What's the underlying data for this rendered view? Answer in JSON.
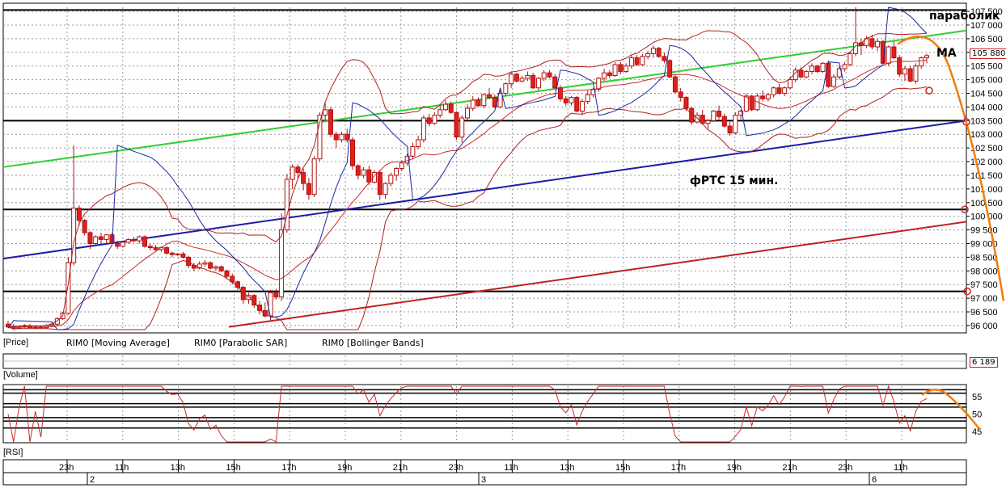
{
  "colors": {
    "candle_up": "#ffffff",
    "candle_down": "#e0201c",
    "moving_average": "#cc2a2a",
    "parabolic_sar": "#1c2aa0",
    "bollinger": "#b02020",
    "green_trend": "#2fd02f",
    "blue_trend": "#1c1ca8",
    "red_trend": "#c02020",
    "orange_projection": "#f07d10",
    "grid": "#9a9a9a",
    "badge_border": "#d02020"
  },
  "annotations": {
    "parabolic": "параболик",
    "ma": "МА",
    "title": "фРТС   15 мин."
  },
  "legend": {
    "price": "[Price]",
    "ma": "RIM0 [Moving Average]",
    "sar": "RIM0 [Parabolic SAR]",
    "bb": "RIM0 [Bollinger Bands]"
  },
  "volume": {
    "label": "[Volume]",
    "value_badge": "6 189"
  },
  "rsi": {
    "label": "[RSI]"
  },
  "price_badge": "105 880",
  "chart_data": [
    {
      "type": "candlestick",
      "title": "фРТС   15 мин.",
      "ylim": [
        95850,
        107650
      ],
      "y_ticks": [
        "96 000",
        "96 500",
        "97 000",
        "97 500",
        "98 000",
        "98 500",
        "99 000",
        "99 500",
        "100 000",
        "100 500",
        "101 000",
        "101 500",
        "102 000",
        "102 500",
        "103 000",
        "103 500",
        "104 000",
        "104 500",
        "105 000",
        "105 500",
        "106 000",
        "106 500",
        "107 000",
        "107 500"
      ],
      "x_ticks": [
        "23h",
        "11h",
        "13h",
        "15h",
        "17h",
        "19h",
        "21h",
        "23h",
        "11h",
        "13h",
        "15h",
        "17h",
        "19h",
        "21h",
        "23h",
        "11h"
      ],
      "day_labels": [
        "2",
        "3",
        "6"
      ],
      "ohlc": [
        [
          96050,
          96180,
          95900,
          95950
        ],
        [
          95950,
          96050,
          95850,
          95900
        ],
        [
          95900,
          96000,
          95870,
          95950
        ],
        [
          95950,
          96050,
          95900,
          95980
        ],
        [
          95980,
          96050,
          95900,
          95920
        ],
        [
          95920,
          96020,
          95880,
          95950
        ],
        [
          95950,
          96000,
          95880,
          95920
        ],
        [
          95920,
          96050,
          95880,
          96000
        ],
        [
          96000,
          96100,
          95950,
          96050
        ],
        [
          96050,
          96300,
          96000,
          96250
        ],
        [
          96250,
          96500,
          96200,
          96450
        ],
        [
          96450,
          98500,
          96400,
          98300
        ],
        [
          98300,
          102600,
          98200,
          100300
        ],
        [
          100300,
          100400,
          99650,
          99850
        ],
        [
          99850,
          99900,
          99300,
          99400
        ],
        [
          99400,
          99450,
          98800,
          99000
        ],
        [
          99000,
          99300,
          98950,
          99250
        ],
        [
          99250,
          99400,
          99000,
          99150
        ],
        [
          99150,
          99350,
          99000,
          99320
        ],
        [
          99320,
          99400,
          98950,
          99000
        ],
        [
          99000,
          99100,
          98800,
          98900
        ],
        [
          98900,
          99100,
          98850,
          99050
        ],
        [
          99050,
          99200,
          99000,
          99150
        ],
        [
          99150,
          99250,
          99050,
          99100
        ],
        [
          99100,
          99300,
          99000,
          99250
        ],
        [
          99250,
          99300,
          98850,
          98900
        ],
        [
          98900,
          99000,
          98750,
          98850
        ],
        [
          98850,
          98950,
          98700,
          98780
        ],
        [
          98780,
          98900,
          98700,
          98850
        ],
        [
          98850,
          98900,
          98600,
          98650
        ],
        [
          98650,
          98700,
          98500,
          98600
        ],
        [
          98600,
          98650,
          98550,
          98620
        ],
        [
          98620,
          98700,
          98450,
          98500
        ],
        [
          98500,
          98550,
          98100,
          98200
        ],
        [
          98200,
          98300,
          98000,
          98100
        ],
        [
          98100,
          98350,
          98050,
          98250
        ],
        [
          98250,
          98400,
          98150,
          98300
        ],
        [
          98300,
          98350,
          98050,
          98100
        ],
        [
          98100,
          98200,
          98000,
          98150
        ],
        [
          98150,
          98200,
          97950,
          98000
        ],
        [
          98000,
          98050,
          97700,
          97800
        ],
        [
          97800,
          97900,
          97500,
          97600
        ],
        [
          97600,
          97650,
          97300,
          97400
        ],
        [
          97400,
          97450,
          96800,
          96950
        ],
        [
          96950,
          97200,
          96800,
          97100
        ],
        [
          97100,
          97150,
          96650,
          96750
        ],
        [
          96750,
          96900,
          96400,
          96550
        ],
        [
          96550,
          96850,
          96300,
          96350
        ],
        [
          96350,
          97300,
          96200,
          97200
        ],
        [
          97200,
          97350,
          96950,
          97050
        ],
        [
          97050,
          100100,
          96900,
          99500
        ],
        [
          99500,
          101550,
          99400,
          101350
        ],
        [
          101350,
          101900,
          101000,
          101800
        ],
        [
          101800,
          101900,
          101400,
          101600
        ],
        [
          101600,
          101750,
          100950,
          101200
        ],
        [
          101200,
          101400,
          100600,
          100800
        ],
        [
          100800,
          102200,
          100700,
          102100
        ],
        [
          102100,
          103800,
          102000,
          103700
        ],
        [
          103700,
          104150,
          103500,
          103900
        ],
        [
          103900,
          104000,
          102900,
          103000
        ],
        [
          103000,
          103100,
          102500,
          102800
        ],
        [
          102800,
          103100,
          102700,
          103000
        ],
        [
          103000,
          103200,
          102700,
          102800
        ],
        [
          102800,
          102900,
          101700,
          101850
        ],
        [
          101850,
          101900,
          101350,
          101500
        ],
        [
          101500,
          101800,
          101400,
          101700
        ],
        [
          101700,
          101850,
          101150,
          101250
        ],
        [
          101250,
          101700,
          101200,
          101600
        ],
        [
          101600,
          101700,
          100600,
          100800
        ],
        [
          100800,
          101250,
          100650,
          101200
        ],
        [
          101200,
          101600,
          101100,
          101500
        ],
        [
          101500,
          101800,
          101300,
          101750
        ],
        [
          101750,
          102050,
          101650,
          101950
        ],
        [
          101950,
          102300,
          101850,
          102200
        ],
        [
          102200,
          102700,
          102100,
          102550
        ],
        [
          102550,
          102950,
          102450,
          102800
        ],
        [
          102800,
          103700,
          102700,
          103600
        ],
        [
          103600,
          103750,
          103300,
          103400
        ],
        [
          103400,
          103800,
          103350,
          103700
        ],
        [
          103700,
          104100,
          103600,
          103900
        ],
        [
          103900,
          104250,
          103850,
          104100
        ],
        [
          104100,
          104200,
          103750,
          103800
        ],
        [
          103800,
          103850,
          102800,
          102900
        ],
        [
          102900,
          103700,
          102700,
          103600
        ],
        [
          103600,
          104100,
          103500,
          103950
        ],
        [
          103950,
          104400,
          103850,
          104250
        ],
        [
          104250,
          104350,
          104000,
          104050
        ],
        [
          104050,
          104500,
          103950,
          104450
        ],
        [
          104450,
          104700,
          104300,
          104350
        ],
        [
          104350,
          104450,
          103950,
          104000
        ],
        [
          104000,
          104600,
          103950,
          104500
        ],
        [
          104500,
          104900,
          104400,
          104850
        ],
        [
          104850,
          105300,
          104700,
          105200
        ],
        [
          105200,
          105250,
          104900,
          104950
        ],
        [
          104950,
          105150,
          104900,
          105050
        ],
        [
          105050,
          105300,
          104950,
          105150
        ],
        [
          105150,
          105250,
          104650,
          104700
        ],
        [
          104700,
          105100,
          104600,
          105050
        ],
        [
          105050,
          105350,
          104950,
          105250
        ],
        [
          105250,
          105350,
          105050,
          105100
        ],
        [
          105100,
          105200,
          104650,
          104700
        ],
        [
          104700,
          104800,
          104200,
          104300
        ],
        [
          104300,
          104400,
          104050,
          104150
        ],
        [
          104150,
          104400,
          104050,
          104350
        ],
        [
          104350,
          104400,
          103800,
          103850
        ],
        [
          103850,
          104300,
          103700,
          104200
        ],
        [
          104200,
          104600,
          104100,
          104450
        ],
        [
          104450,
          104700,
          104350,
          104650
        ],
        [
          104650,
          105100,
          104550,
          105050
        ],
        [
          105050,
          105400,
          104950,
          105250
        ],
        [
          105250,
          105350,
          105050,
          105150
        ],
        [
          105150,
          105650,
          105100,
          105550
        ],
        [
          105550,
          105650,
          105200,
          105300
        ],
        [
          105300,
          105600,
          105250,
          105500
        ],
        [
          105500,
          105900,
          105400,
          105800
        ],
        [
          105800,
          105900,
          105500,
          105550
        ],
        [
          105550,
          105950,
          105500,
          105850
        ],
        [
          105850,
          106050,
          105750,
          105950
        ],
        [
          105950,
          106250,
          105800,
          106150
        ],
        [
          106150,
          106200,
          105800,
          105850
        ],
        [
          105850,
          106000,
          105600,
          105700
        ],
        [
          105700,
          105750,
          105050,
          105100
        ],
        [
          105100,
          105200,
          104500,
          104550
        ],
        [
          104550,
          104700,
          104200,
          104350
        ],
        [
          104350,
          104400,
          103850,
          103950
        ],
        [
          103950,
          104000,
          103350,
          103450
        ],
        [
          103450,
          103800,
          103400,
          103700
        ],
        [
          103700,
          103900,
          103350,
          103400
        ],
        [
          103400,
          103550,
          103200,
          103500
        ],
        [
          103500,
          103900,
          103450,
          103850
        ],
        [
          103850,
          104050,
          103550,
          103650
        ],
        [
          103650,
          103750,
          103250,
          103300
        ],
        [
          103300,
          103450,
          102950,
          103050
        ],
        [
          103050,
          103800,
          103000,
          103700
        ],
        [
          103700,
          103900,
          103550,
          103850
        ],
        [
          103850,
          104500,
          103800,
          104400
        ],
        [
          104400,
          104450,
          103850,
          103900
        ],
        [
          103900,
          104500,
          103850,
          104400
        ],
        [
          104400,
          104600,
          104200,
          104300
        ],
        [
          104300,
          104500,
          104200,
          104450
        ],
        [
          104450,
          104750,
          104350,
          104700
        ],
        [
          104700,
          104850,
          104450,
          104500
        ],
        [
          104500,
          104750,
          104400,
          104700
        ],
        [
          104700,
          105100,
          104650,
          105000
        ],
        [
          105000,
          105450,
          104900,
          105350
        ],
        [
          105350,
          105450,
          105050,
          105100
        ],
        [
          105100,
          105350,
          105050,
          105300
        ],
        [
          105300,
          105600,
          105200,
          105500
        ],
        [
          105500,
          105550,
          105250,
          105300
        ],
        [
          105300,
          105650,
          105250,
          105600
        ],
        [
          105600,
          105700,
          104700,
          104750
        ],
        [
          104750,
          105200,
          104700,
          105100
        ],
        [
          105100,
          105500,
          105000,
          105400
        ],
        [
          105400,
          105650,
          105300,
          105550
        ],
        [
          105550,
          106000,
          105500,
          105950
        ],
        [
          105950,
          107650,
          105850,
          106350
        ],
        [
          106350,
          106500,
          105900,
          106250
        ],
        [
          106250,
          106600,
          106150,
          106500
        ],
        [
          106500,
          106650,
          106100,
          106200
        ],
        [
          106200,
          106500,
          106050,
          106400
        ],
        [
          106400,
          106450,
          105550,
          105600
        ],
        [
          105600,
          106250,
          105500,
          106200
        ],
        [
          106200,
          106400,
          105750,
          105800
        ],
        [
          105800,
          105900,
          105100,
          105200
        ],
        [
          105200,
          105500,
          104950,
          105400
        ],
        [
          105400,
          105500,
          104900,
          104950
        ],
        [
          104950,
          105600,
          104850,
          105500
        ],
        [
          105500,
          105850,
          105400,
          105800
        ],
        [
          105800,
          105950,
          105600,
          105880
        ]
      ]
    }
  ]
}
